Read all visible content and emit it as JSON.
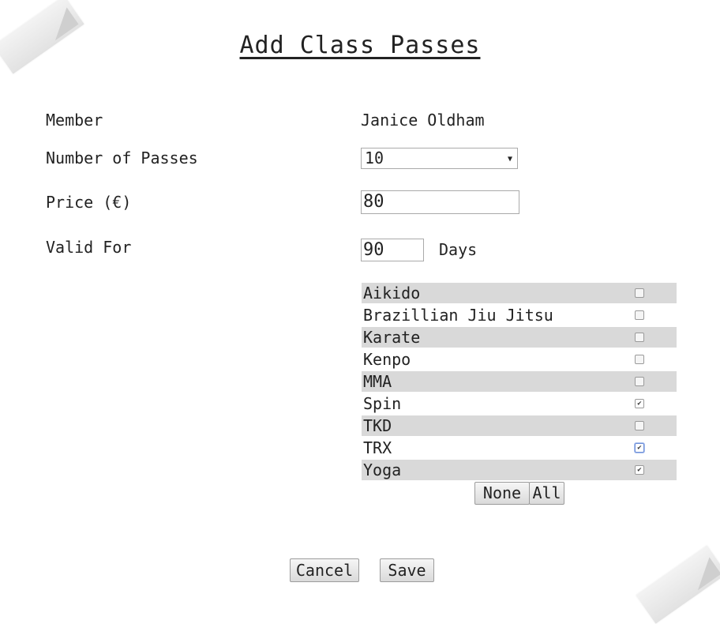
{
  "title": "Add Class Passes",
  "member": {
    "label": "Member",
    "value": "Janice Oldham"
  },
  "passes": {
    "label": "Number of Passes",
    "selected": "10"
  },
  "price": {
    "label": "Price (€)",
    "value": "80"
  },
  "valid": {
    "label": "Valid For",
    "value": "90",
    "unit": "Days"
  },
  "classes": [
    {
      "name": "Aikido",
      "checked": false
    },
    {
      "name": "Brazillian Jiu Jitsu",
      "checked": false
    },
    {
      "name": "Karate",
      "checked": false
    },
    {
      "name": "Kenpo",
      "checked": false
    },
    {
      "name": "MMA",
      "checked": false
    },
    {
      "name": "Spin",
      "checked": true
    },
    {
      "name": "TKD",
      "checked": false
    },
    {
      "name": "TRX",
      "checked": true
    },
    {
      "name": "Yoga",
      "checked": true
    }
  ],
  "buttons": {
    "none": "None",
    "all": "All",
    "cancel": "Cancel",
    "save": "Save"
  }
}
